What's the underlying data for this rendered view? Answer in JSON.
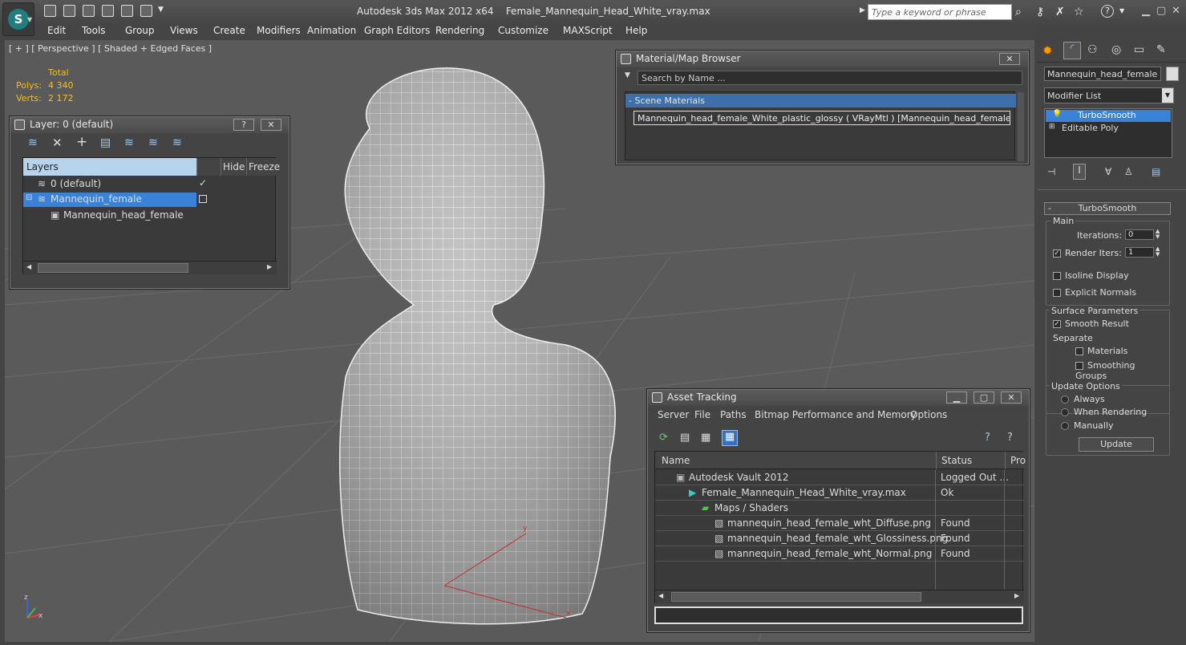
{
  "app": {
    "title": "Autodesk 3ds Max  2012 x64",
    "file": "Female_Mannequin_Head_White_vray.max"
  },
  "search": {
    "placeholder": "Type a keyword or phrase"
  },
  "menu": [
    "Edit",
    "Tools",
    "Group",
    "Views",
    "Create",
    "Modifiers",
    "Animation",
    "Graph Editors",
    "Rendering",
    "Customize",
    "MAXScript",
    "Help"
  ],
  "viewport": {
    "label": "[ + ] [ Perspective ] [ Shaded + Edged Faces ]",
    "stats_header": "Total",
    "polys_label": "Polys:",
    "polys": "4 340",
    "verts_label": "Verts:",
    "verts": "2 172"
  },
  "layer_panel": {
    "title": "Layer: 0 (default)",
    "help": "?",
    "close": "✕",
    "col_layers": "Layers",
    "col_hide": "Hide",
    "col_freeze": "Freeze",
    "rows": [
      "0 (default)",
      "Mannequin_female",
      "Mannequin_head_female"
    ]
  },
  "material_browser": {
    "title": "Material/Map Browser",
    "search_placeholder": "Search by Name ...",
    "section": "Scene Materials",
    "item": "Mannequin_head_female_White_plastic_glossy  ( VRayMtl ) [Mannequin_head_female]"
  },
  "asset_tracking": {
    "title": "Asset Tracking",
    "menu": [
      "Server",
      "File",
      "Paths",
      "Bitmap Performance and Memory",
      "Options"
    ],
    "col_name": "Name",
    "col_status": "Status",
    "col_pro": "Pro",
    "rows": [
      {
        "name": "Autodesk Vault 2012",
        "status": "Logged Out ..."
      },
      {
        "name": "Female_Mannequin_Head_White_vray.max",
        "status": "Ok"
      },
      {
        "name": "Maps / Shaders",
        "status": ""
      },
      {
        "name": "mannequin_head_female_wht_Diffuse.png",
        "status": "Found"
      },
      {
        "name": "mannequin_head_female_wht_Glossiness.png",
        "status": "Found"
      },
      {
        "name": "mannequin_head_female_wht_Normal.png",
        "status": "Found"
      }
    ]
  },
  "command_panel": {
    "object_name": "Mannequin_head_female",
    "modifier_list": "Modifier List",
    "stack": [
      "TurboSmooth",
      "Editable Poly"
    ],
    "rollout": "TurboSmooth",
    "main": "Main",
    "iterations_label": "Iterations:",
    "iterations": "0",
    "render_iters_label": "Render Iters:",
    "render_iters": "1",
    "isoline": "Isoline Display",
    "explicit": "Explicit Normals",
    "surface": "Surface Parameters",
    "smooth_result": "Smooth Result",
    "separate": "Separate",
    "materials": "Materials",
    "smoothing_groups": "Smoothing Groups",
    "update_options": "Update Options",
    "always": "Always",
    "when_rendering": "When Rendering",
    "manually": "Manually",
    "update": "Update"
  },
  "axes": {
    "x": "x",
    "y": "y",
    "z": "z"
  }
}
